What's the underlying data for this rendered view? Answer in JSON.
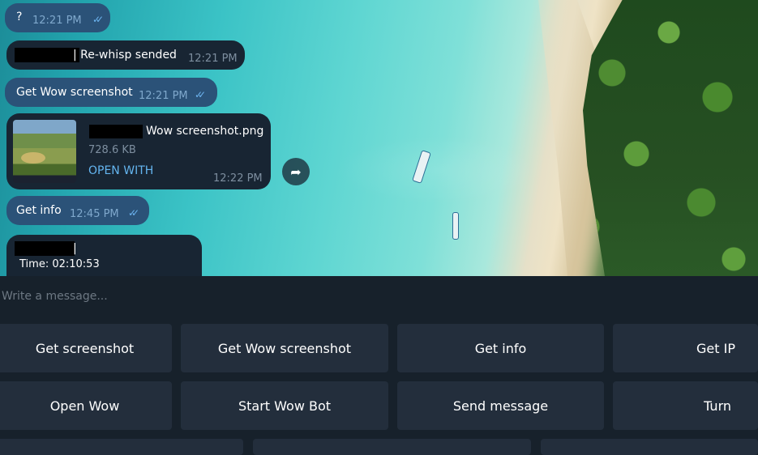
{
  "messages": [
    {
      "text": "?",
      "time": "12:21 PM"
    },
    {
      "text": "| Re-whisp sended",
      "time": "12:21 PM"
    },
    {
      "text": "Get Wow screenshot",
      "time": "12:21 PM"
    },
    {
      "filename": "Wow screenshot.png",
      "size": "728.6 KB",
      "action": "OPEN WITH",
      "time": "12:22 PM"
    },
    {
      "text": "Get info",
      "time": "12:45 PM"
    },
    {
      "line1": "|",
      "line2": "Time: 02:10:53"
    }
  ],
  "composer": {
    "placeholder": "Write a message..."
  },
  "keyboard": {
    "row1": [
      "Get screenshot",
      "Get Wow screenshot",
      "Get info",
      "Get IP"
    ],
    "row2": [
      "Open Wow",
      "Start Wow Bot",
      "Send message",
      "Turn"
    ]
  },
  "icons": {
    "checks": "double-check-icon",
    "forward": "forward-arrow-icon"
  },
  "colors": {
    "incoming": "#182533",
    "outgoing": "#2b5278",
    "link": "#64b5ef",
    "check": "#6cb4f0"
  }
}
